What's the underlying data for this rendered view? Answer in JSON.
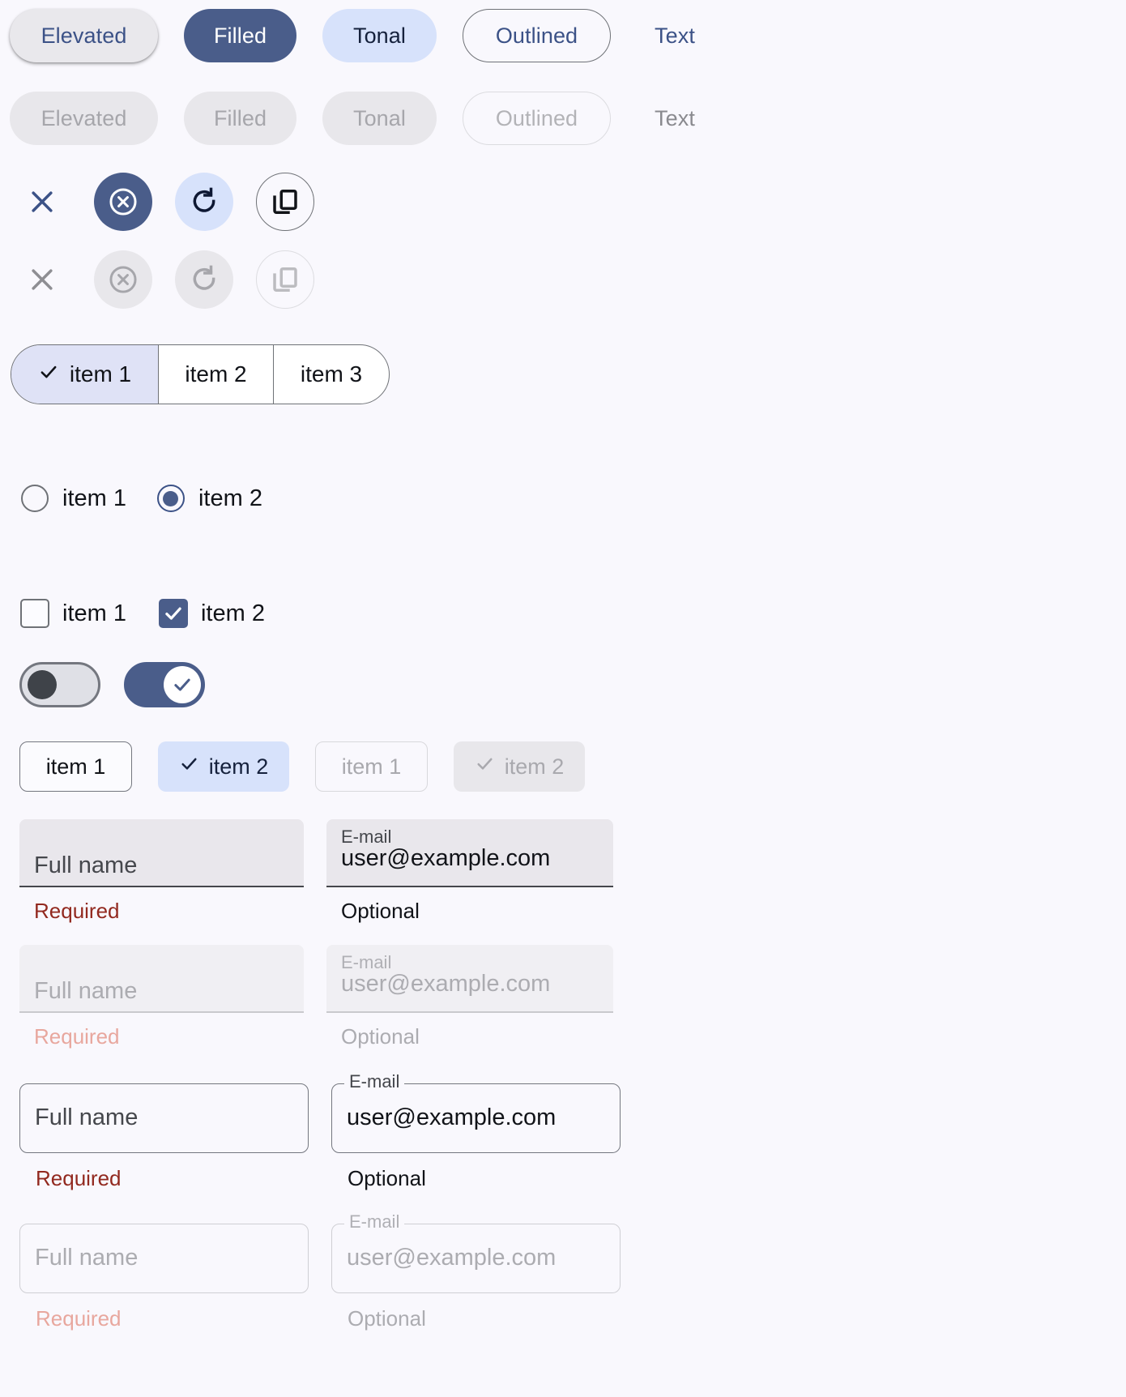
{
  "theme": {
    "background": "#f9f8fd",
    "primary": "#4a5d8a",
    "on_primary": "#ffffff",
    "primary_text": "#3c5287",
    "tonal_container": "#d7e2fb",
    "on_tonal": "#15213c",
    "elevated_surface": "#e9e8ec",
    "outline": "#6f7277",
    "disabled_bg": "#e8e7eb",
    "disabled_fg": "#a6a6ab",
    "error": "#92291f",
    "error_disabled": "#e8a79e",
    "filled_field_bg": "#e9e7ec",
    "segmented_selected_bg": "#dfe2f6"
  },
  "buttons": {
    "enabled": [
      {
        "label": "Elevated",
        "variant": "elevated"
      },
      {
        "label": "Filled",
        "variant": "filled"
      },
      {
        "label": "Tonal",
        "variant": "tonal"
      },
      {
        "label": "Outlined",
        "variant": "outlined"
      },
      {
        "label": "Text",
        "variant": "text"
      }
    ],
    "disabled": [
      {
        "label": "Elevated",
        "variant": "elevated"
      },
      {
        "label": "Filled",
        "variant": "filled"
      },
      {
        "label": "Tonal",
        "variant": "tonal"
      },
      {
        "label": "Outlined",
        "variant": "outlined"
      },
      {
        "label": "Text",
        "variant": "text"
      }
    ]
  },
  "icon_buttons": {
    "enabled": [
      {
        "icon": "close-icon",
        "variant": "standard"
      },
      {
        "icon": "highlight-off-icon",
        "variant": "filled"
      },
      {
        "icon": "refresh-icon",
        "variant": "tonal"
      },
      {
        "icon": "copy-icon",
        "variant": "outlined"
      }
    ],
    "disabled": [
      {
        "icon": "close-icon",
        "variant": "standard"
      },
      {
        "icon": "highlight-off-icon",
        "variant": "filled"
      },
      {
        "icon": "refresh-icon",
        "variant": "tonal"
      },
      {
        "icon": "copy-icon",
        "variant": "outlined"
      }
    ]
  },
  "segmented": {
    "items": [
      {
        "label": "item 1",
        "selected": true
      },
      {
        "label": "item 2",
        "selected": false
      },
      {
        "label": "item 3",
        "selected": false
      }
    ]
  },
  "radios": [
    {
      "label": "item 1",
      "checked": false
    },
    {
      "label": "item 2",
      "checked": true
    }
  ],
  "checkboxes": [
    {
      "label": "item 1",
      "checked": false
    },
    {
      "label": "item 2",
      "checked": true
    }
  ],
  "switches": [
    {
      "on": false
    },
    {
      "on": true
    }
  ],
  "chips": [
    {
      "label": "item 1",
      "selected": false,
      "disabled": false
    },
    {
      "label": "item 2",
      "selected": true,
      "disabled": false
    },
    {
      "label": "item 1",
      "selected": false,
      "disabled": true
    },
    {
      "label": "item 2",
      "selected": true,
      "disabled": true
    }
  ],
  "text_fields": {
    "filled_enabled": {
      "name": {
        "placeholder": "Full name",
        "value": "",
        "helper": "Required"
      },
      "email": {
        "label": "E-mail",
        "value": "user@example.com",
        "helper": "Optional"
      }
    },
    "filled_disabled": {
      "name": {
        "placeholder": "Full name",
        "value": "",
        "helper": "Required"
      },
      "email": {
        "label": "E-mail",
        "value": "user@example.com",
        "helper": "Optional"
      }
    },
    "outlined_enabled": {
      "name": {
        "placeholder": "Full name",
        "value": "",
        "helper": "Required"
      },
      "email": {
        "label": "E-mail",
        "value": "user@example.com",
        "helper": "Optional"
      }
    },
    "outlined_disabled": {
      "name": {
        "placeholder": "Full name",
        "value": "",
        "helper": "Required"
      },
      "email": {
        "label": "E-mail",
        "value": "user@example.com",
        "helper": "Optional"
      }
    }
  }
}
